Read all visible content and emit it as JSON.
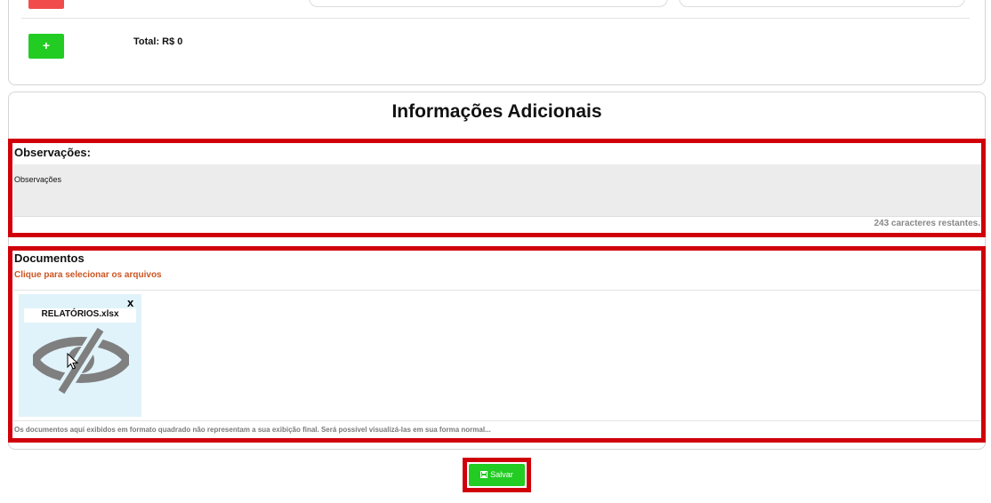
{
  "totals": {
    "label": "Total: R$ 0"
  },
  "add_button": {
    "label": "+"
  },
  "section": {
    "title": "Informações Adicionais"
  },
  "observations": {
    "label": "Observações:",
    "placeholder": "Observações",
    "remaining": "243 caracteres restantes."
  },
  "documents": {
    "title": "Documentos",
    "select_link": "Clique para selecionar os arquivos",
    "files": [
      {
        "name": "RELATÓRIOS.xlsx",
        "remove_label": "x",
        "preview_icon": "eye-slash-icon"
      }
    ],
    "note": "Os documentos aqui exibidos em formato quadrado não representam a sua exibição final. Será possível visualizá-las em sua forma normal..."
  },
  "save_button": {
    "label": "Salvar",
    "icon": "save-icon"
  },
  "colors": {
    "highlight_red": "#d0000b",
    "accent_green": "#22cc22",
    "danger_red": "#f24b4b",
    "link_orange": "#cc5522",
    "file_bg": "#e1f3fa"
  }
}
